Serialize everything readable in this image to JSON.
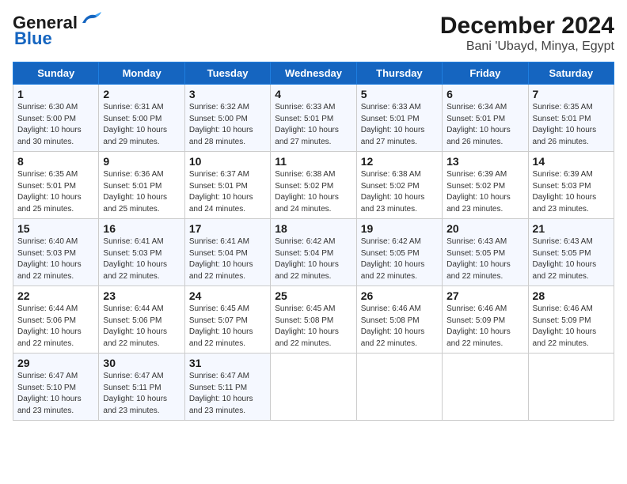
{
  "header": {
    "logo_line1": "General",
    "logo_line2": "Blue",
    "title": "December 2024",
    "subtitle": "Bani 'Ubayd, Minya, Egypt"
  },
  "days_of_week": [
    "Sunday",
    "Monday",
    "Tuesday",
    "Wednesday",
    "Thursday",
    "Friday",
    "Saturday"
  ],
  "weeks": [
    [
      {
        "day": "1",
        "info": "Sunrise: 6:30 AM\nSunset: 5:00 PM\nDaylight: 10 hours\nand 30 minutes."
      },
      {
        "day": "2",
        "info": "Sunrise: 6:31 AM\nSunset: 5:00 PM\nDaylight: 10 hours\nand 29 minutes."
      },
      {
        "day": "3",
        "info": "Sunrise: 6:32 AM\nSunset: 5:00 PM\nDaylight: 10 hours\nand 28 minutes."
      },
      {
        "day": "4",
        "info": "Sunrise: 6:33 AM\nSunset: 5:01 PM\nDaylight: 10 hours\nand 27 minutes."
      },
      {
        "day": "5",
        "info": "Sunrise: 6:33 AM\nSunset: 5:01 PM\nDaylight: 10 hours\nand 27 minutes."
      },
      {
        "day": "6",
        "info": "Sunrise: 6:34 AM\nSunset: 5:01 PM\nDaylight: 10 hours\nand 26 minutes."
      },
      {
        "day": "7",
        "info": "Sunrise: 6:35 AM\nSunset: 5:01 PM\nDaylight: 10 hours\nand 26 minutes."
      }
    ],
    [
      {
        "day": "8",
        "info": "Sunrise: 6:35 AM\nSunset: 5:01 PM\nDaylight: 10 hours\nand 25 minutes."
      },
      {
        "day": "9",
        "info": "Sunrise: 6:36 AM\nSunset: 5:01 PM\nDaylight: 10 hours\nand 25 minutes."
      },
      {
        "day": "10",
        "info": "Sunrise: 6:37 AM\nSunset: 5:01 PM\nDaylight: 10 hours\nand 24 minutes."
      },
      {
        "day": "11",
        "info": "Sunrise: 6:38 AM\nSunset: 5:02 PM\nDaylight: 10 hours\nand 24 minutes."
      },
      {
        "day": "12",
        "info": "Sunrise: 6:38 AM\nSunset: 5:02 PM\nDaylight: 10 hours\nand 23 minutes."
      },
      {
        "day": "13",
        "info": "Sunrise: 6:39 AM\nSunset: 5:02 PM\nDaylight: 10 hours\nand 23 minutes."
      },
      {
        "day": "14",
        "info": "Sunrise: 6:39 AM\nSunset: 5:03 PM\nDaylight: 10 hours\nand 23 minutes."
      }
    ],
    [
      {
        "day": "15",
        "info": "Sunrise: 6:40 AM\nSunset: 5:03 PM\nDaylight: 10 hours\nand 22 minutes."
      },
      {
        "day": "16",
        "info": "Sunrise: 6:41 AM\nSunset: 5:03 PM\nDaylight: 10 hours\nand 22 minutes."
      },
      {
        "day": "17",
        "info": "Sunrise: 6:41 AM\nSunset: 5:04 PM\nDaylight: 10 hours\nand 22 minutes."
      },
      {
        "day": "18",
        "info": "Sunrise: 6:42 AM\nSunset: 5:04 PM\nDaylight: 10 hours\nand 22 minutes."
      },
      {
        "day": "19",
        "info": "Sunrise: 6:42 AM\nSunset: 5:05 PM\nDaylight: 10 hours\nand 22 minutes."
      },
      {
        "day": "20",
        "info": "Sunrise: 6:43 AM\nSunset: 5:05 PM\nDaylight: 10 hours\nand 22 minutes."
      },
      {
        "day": "21",
        "info": "Sunrise: 6:43 AM\nSunset: 5:05 PM\nDaylight: 10 hours\nand 22 minutes."
      }
    ],
    [
      {
        "day": "22",
        "info": "Sunrise: 6:44 AM\nSunset: 5:06 PM\nDaylight: 10 hours\nand 22 minutes."
      },
      {
        "day": "23",
        "info": "Sunrise: 6:44 AM\nSunset: 5:06 PM\nDaylight: 10 hours\nand 22 minutes."
      },
      {
        "day": "24",
        "info": "Sunrise: 6:45 AM\nSunset: 5:07 PM\nDaylight: 10 hours\nand 22 minutes."
      },
      {
        "day": "25",
        "info": "Sunrise: 6:45 AM\nSunset: 5:08 PM\nDaylight: 10 hours\nand 22 minutes."
      },
      {
        "day": "26",
        "info": "Sunrise: 6:46 AM\nSunset: 5:08 PM\nDaylight: 10 hours\nand 22 minutes."
      },
      {
        "day": "27",
        "info": "Sunrise: 6:46 AM\nSunset: 5:09 PM\nDaylight: 10 hours\nand 22 minutes."
      },
      {
        "day": "28",
        "info": "Sunrise: 6:46 AM\nSunset: 5:09 PM\nDaylight: 10 hours\nand 22 minutes."
      }
    ],
    [
      {
        "day": "29",
        "info": "Sunrise: 6:47 AM\nSunset: 5:10 PM\nDaylight: 10 hours\nand 23 minutes."
      },
      {
        "day": "30",
        "info": "Sunrise: 6:47 AM\nSunset: 5:11 PM\nDaylight: 10 hours\nand 23 minutes."
      },
      {
        "day": "31",
        "info": "Sunrise: 6:47 AM\nSunset: 5:11 PM\nDaylight: 10 hours\nand 23 minutes."
      },
      {
        "day": "",
        "info": ""
      },
      {
        "day": "",
        "info": ""
      },
      {
        "day": "",
        "info": ""
      },
      {
        "day": "",
        "info": ""
      }
    ]
  ]
}
